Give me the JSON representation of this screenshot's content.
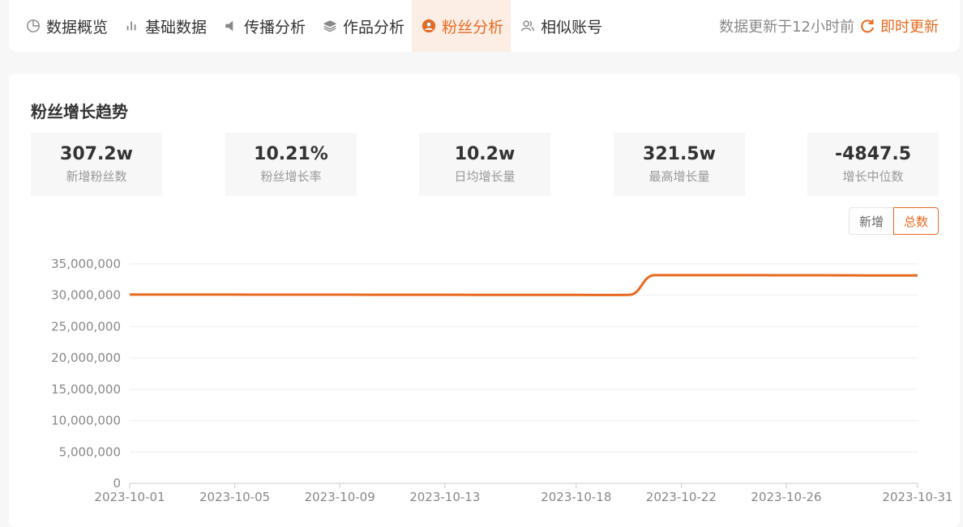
{
  "nav": {
    "tabs": [
      {
        "label": "数据概览",
        "icon": "pie-chart-icon"
      },
      {
        "label": "基础数据",
        "icon": "bar-chart-icon"
      },
      {
        "label": "传播分析",
        "icon": "speaker-icon"
      },
      {
        "label": "作品分析",
        "icon": "layers-icon"
      },
      {
        "label": "粉丝分析",
        "icon": "user-circle-icon",
        "active": true
      },
      {
        "label": "相似账号",
        "icon": "users-icon"
      }
    ],
    "update_text": "数据更新于12小时前",
    "refresh_label": "即时更新"
  },
  "section": {
    "title": "粉丝增长趋势",
    "stats": [
      {
        "value": "307.2w",
        "label": "新增粉丝数"
      },
      {
        "value": "10.21%",
        "label": "粉丝增长率"
      },
      {
        "value": "10.2w",
        "label": "日均增长量"
      },
      {
        "value": "321.5w",
        "label": "最高增长量"
      },
      {
        "value": "-4847.5",
        "label": "增长中位数"
      }
    ],
    "toggle": {
      "new_label": "新增",
      "total_label": "总数",
      "selected": "总数"
    }
  },
  "colors": {
    "accent": "#e8691f",
    "grid": "#eeeeee"
  },
  "chart_data": {
    "type": "line",
    "title": "",
    "xlabel": "",
    "ylabel": "",
    "ylim": [
      0,
      35000000
    ],
    "yticks": [
      0,
      5000000,
      10000000,
      15000000,
      20000000,
      25000000,
      30000000,
      35000000
    ],
    "ytick_labels": [
      "0",
      "5,000,000",
      "10,000,000",
      "15,000,000",
      "20,000,000",
      "25,000,000",
      "30,000,000",
      "35,000,000"
    ],
    "xtick_labels": [
      "2023-10-01",
      "2023-10-05",
      "2023-10-09",
      "2023-10-13",
      "2023-10-18",
      "2023-10-22",
      "2023-10-26",
      "2023-10-31"
    ],
    "grid": true,
    "series": [
      {
        "color": "#e8691f",
        "x": [
          "2023-10-01",
          "2023-10-02",
          "2023-10-03",
          "2023-10-04",
          "2023-10-05",
          "2023-10-06",
          "2023-10-07",
          "2023-10-08",
          "2023-10-09",
          "2023-10-10",
          "2023-10-11",
          "2023-10-12",
          "2023-10-13",
          "2023-10-14",
          "2023-10-15",
          "2023-10-16",
          "2023-10-17",
          "2023-10-18",
          "2023-10-19",
          "2023-10-20",
          "2023-10-21",
          "2023-10-22",
          "2023-10-23",
          "2023-10-24",
          "2023-10-25",
          "2023-10-26",
          "2023-10-27",
          "2023-10-28",
          "2023-10-29",
          "2023-10-30",
          "2023-10-31"
        ],
        "values": [
          30100000,
          30100000,
          30100000,
          30100000,
          30100000,
          30095000,
          30090000,
          30090000,
          30090000,
          30085000,
          30080000,
          30080000,
          30075000,
          30070000,
          30065000,
          30060000,
          30055000,
          30050000,
          30040000,
          30050000,
          33200000,
          33210000,
          33205000,
          33200000,
          33200000,
          33195000,
          33190000,
          33180000,
          33170000,
          33160000,
          33150000
        ]
      }
    ]
  }
}
